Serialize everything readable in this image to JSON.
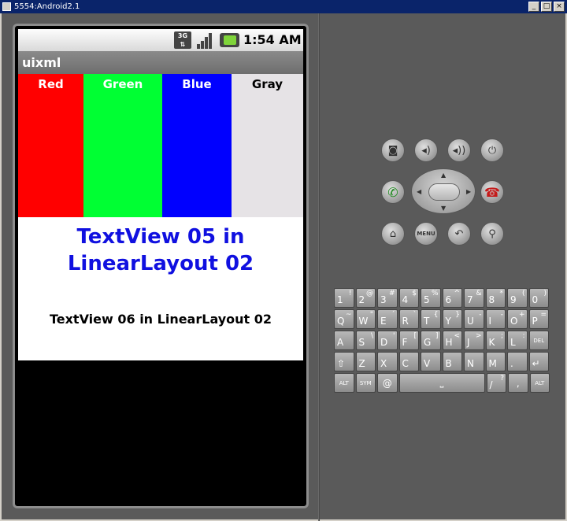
{
  "window": {
    "title": "5554:Android2.1",
    "controls": [
      "_",
      "□",
      "×"
    ]
  },
  "status_bar": {
    "network": "3G",
    "time": "1:54 AM"
  },
  "app": {
    "title": "uixml"
  },
  "color_columns": [
    {
      "label": "Red",
      "bg": "#ff0000",
      "fg": "#ffffff"
    },
    {
      "label": "Green",
      "bg": "#00ff33",
      "fg": "#ffffff"
    },
    {
      "label": "Blue",
      "bg": "#0000ff",
      "fg": "#ffffff"
    },
    {
      "label": "Gray",
      "bg": "#e6e3e6",
      "fg": "#000000"
    }
  ],
  "content": {
    "textview05": "TextView 05 in LinearLayout 02",
    "textview06": "TextView 06 in LinearLayout 02"
  },
  "hardware_buttons": {
    "camera": "camera-icon",
    "volume_down": "volume-down-icon",
    "volume_up": "volume-up-icon",
    "power": "power-icon",
    "call": "call-icon",
    "end_call": "end-call-icon",
    "home": "home-icon",
    "menu": "MENU",
    "back": "back-icon",
    "search": "search-icon"
  },
  "keyboard": {
    "row1": [
      [
        "1",
        "!"
      ],
      [
        "2",
        "@"
      ],
      [
        "3",
        "#"
      ],
      [
        "4",
        "$"
      ],
      [
        "5",
        "%"
      ],
      [
        "6",
        "^"
      ],
      [
        "7",
        "&"
      ],
      [
        "8",
        "*"
      ],
      [
        "9",
        "("
      ],
      [
        "0",
        ")"
      ]
    ],
    "row2": [
      [
        "Q",
        "~"
      ],
      [
        "W",
        "\""
      ],
      [
        "E",
        "´"
      ],
      [
        "R",
        "`"
      ],
      [
        "T",
        "{"
      ],
      [
        "Y",
        "}"
      ],
      [
        "U",
        "-"
      ],
      [
        "I",
        "-"
      ],
      [
        "O",
        "+"
      ],
      [
        "P",
        "="
      ]
    ],
    "row3": [
      [
        "A",
        ""
      ],
      [
        "S",
        "\\"
      ],
      [
        "D",
        "'"
      ],
      [
        "F",
        "["
      ],
      [
        "G",
        "]"
      ],
      [
        "H",
        "<"
      ],
      [
        "J",
        ">"
      ],
      [
        "K",
        ";"
      ],
      [
        "L",
        ":"
      ],
      [
        "DEL",
        ""
      ]
    ],
    "row4": [
      [
        "⇧",
        ""
      ],
      [
        "Z",
        ""
      ],
      [
        "X",
        ""
      ],
      [
        "C",
        ""
      ],
      [
        "V",
        ""
      ],
      [
        "B",
        ""
      ],
      [
        "N",
        ""
      ],
      [
        "M",
        ""
      ],
      [
        ".",
        ""
      ],
      [
        "↵",
        ""
      ]
    ],
    "row5": {
      "alt_left": "ALT",
      "sym": "SYM",
      "at": "@",
      "space": "⎵",
      "slash": "/",
      "question": "?",
      "comma": ",",
      "alt_right": "ALT"
    }
  }
}
